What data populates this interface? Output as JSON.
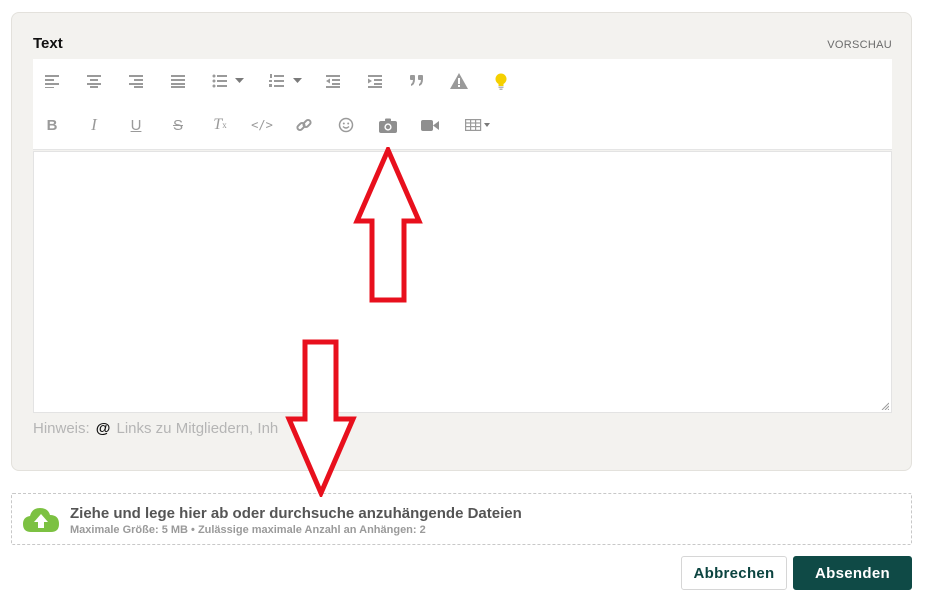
{
  "editor": {
    "label": "Text",
    "preview": "VORSCHAU",
    "toolbar_row1": [
      "align-left-icon",
      "align-center-icon",
      "align-right-icon",
      "align-justify-icon",
      "bullet-list-icon",
      "bullet-list-dropdown-icon",
      "numbered-list-icon",
      "numbered-list-dropdown-icon",
      "outdent-icon",
      "indent-icon",
      "quote-icon",
      "warning-icon",
      "lightbulb-icon"
    ],
    "toolbar_row2": [
      "bold-icon",
      "italic-icon",
      "underline-icon",
      "strikethrough-icon",
      "clear-format-icon",
      "code-icon",
      "link-icon",
      "emoji-icon",
      "camera-icon",
      "video-icon",
      "table-icon"
    ],
    "hint_label": "Hinweis:",
    "hint_at": "@",
    "hint_text": "Links zu Mitgliedern, Inh"
  },
  "upload": {
    "main_prefix": "Ziehe und lege hier ab oder",
    "browse": "durchsuche",
    "main_suffix": "anzuhängende Dateien",
    "sub": "Maximale Größe: 5 MB • Zulässige maximale Anzahl an Anhängen: 2"
  },
  "actions": {
    "cancel": "Abbrechen",
    "submit": "Absenden"
  },
  "colors": {
    "accent": "#0f4a46",
    "annotation_arrow": "#e8101d",
    "upload_icon": "#7cc142",
    "lightbulb": "#f5d000"
  }
}
